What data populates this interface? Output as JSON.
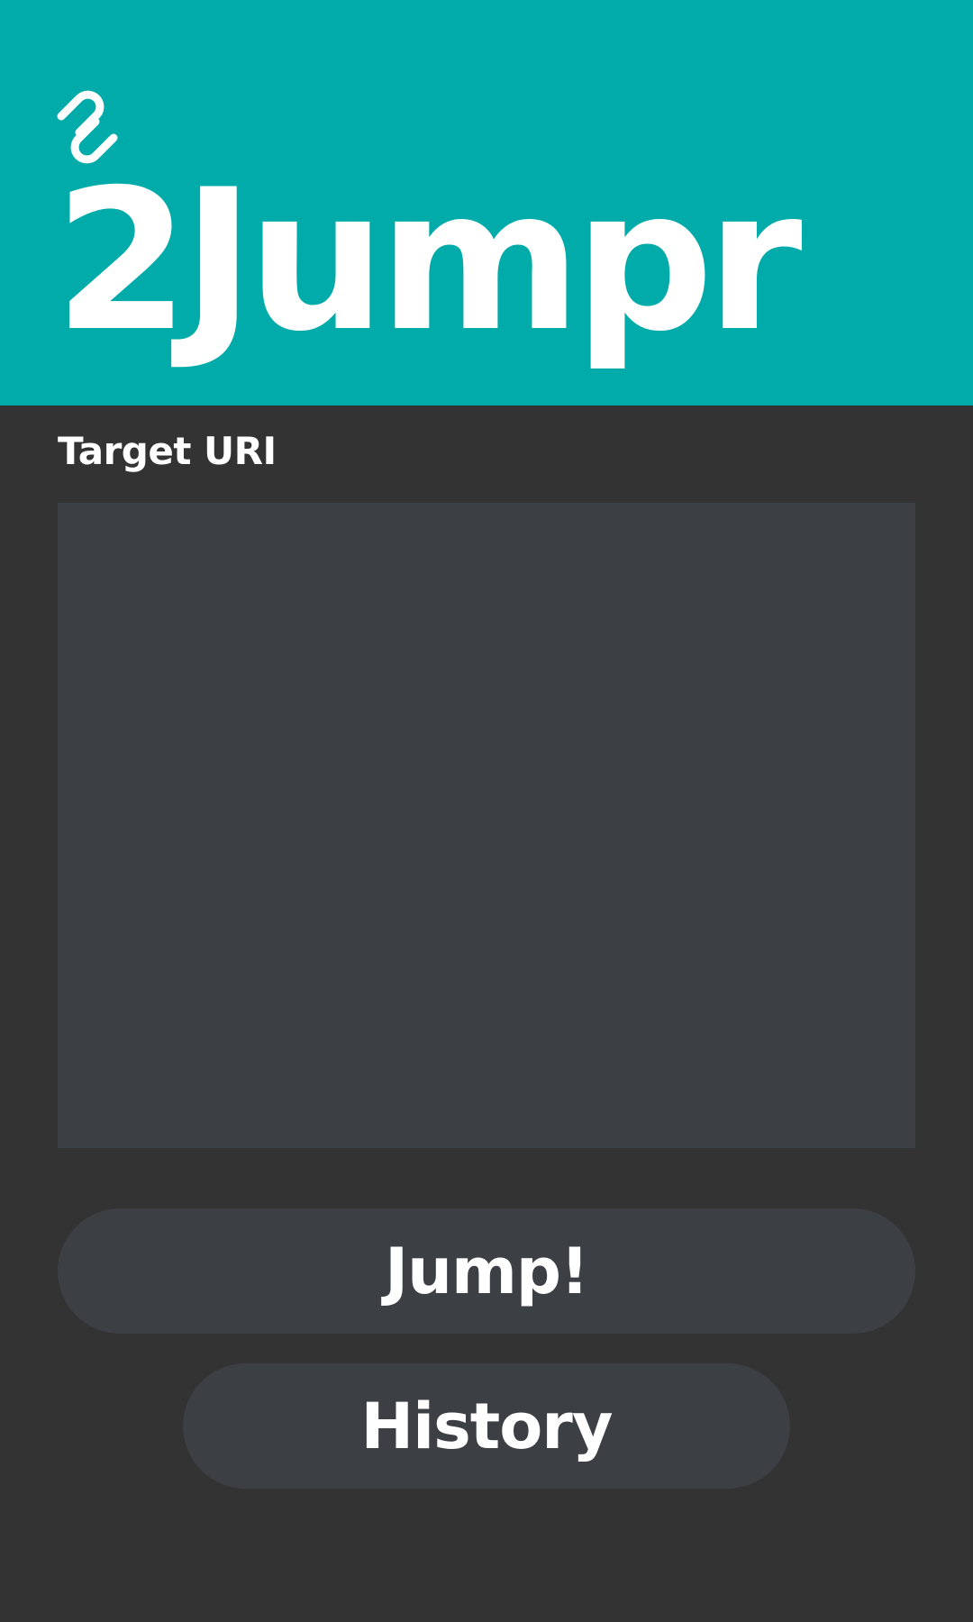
{
  "app": {
    "title": "2Jumpr",
    "logo_icon": "paperclip-link-icon"
  },
  "form": {
    "label": "Target URI",
    "uri_value": "",
    "uri_placeholder": ""
  },
  "actions": {
    "jump_label": "Jump!",
    "history_label": "History"
  },
  "colors": {
    "header_background": "#01abaa",
    "page_background": "#333333",
    "control_background": "#3c3f44",
    "text": "#ffffff"
  }
}
